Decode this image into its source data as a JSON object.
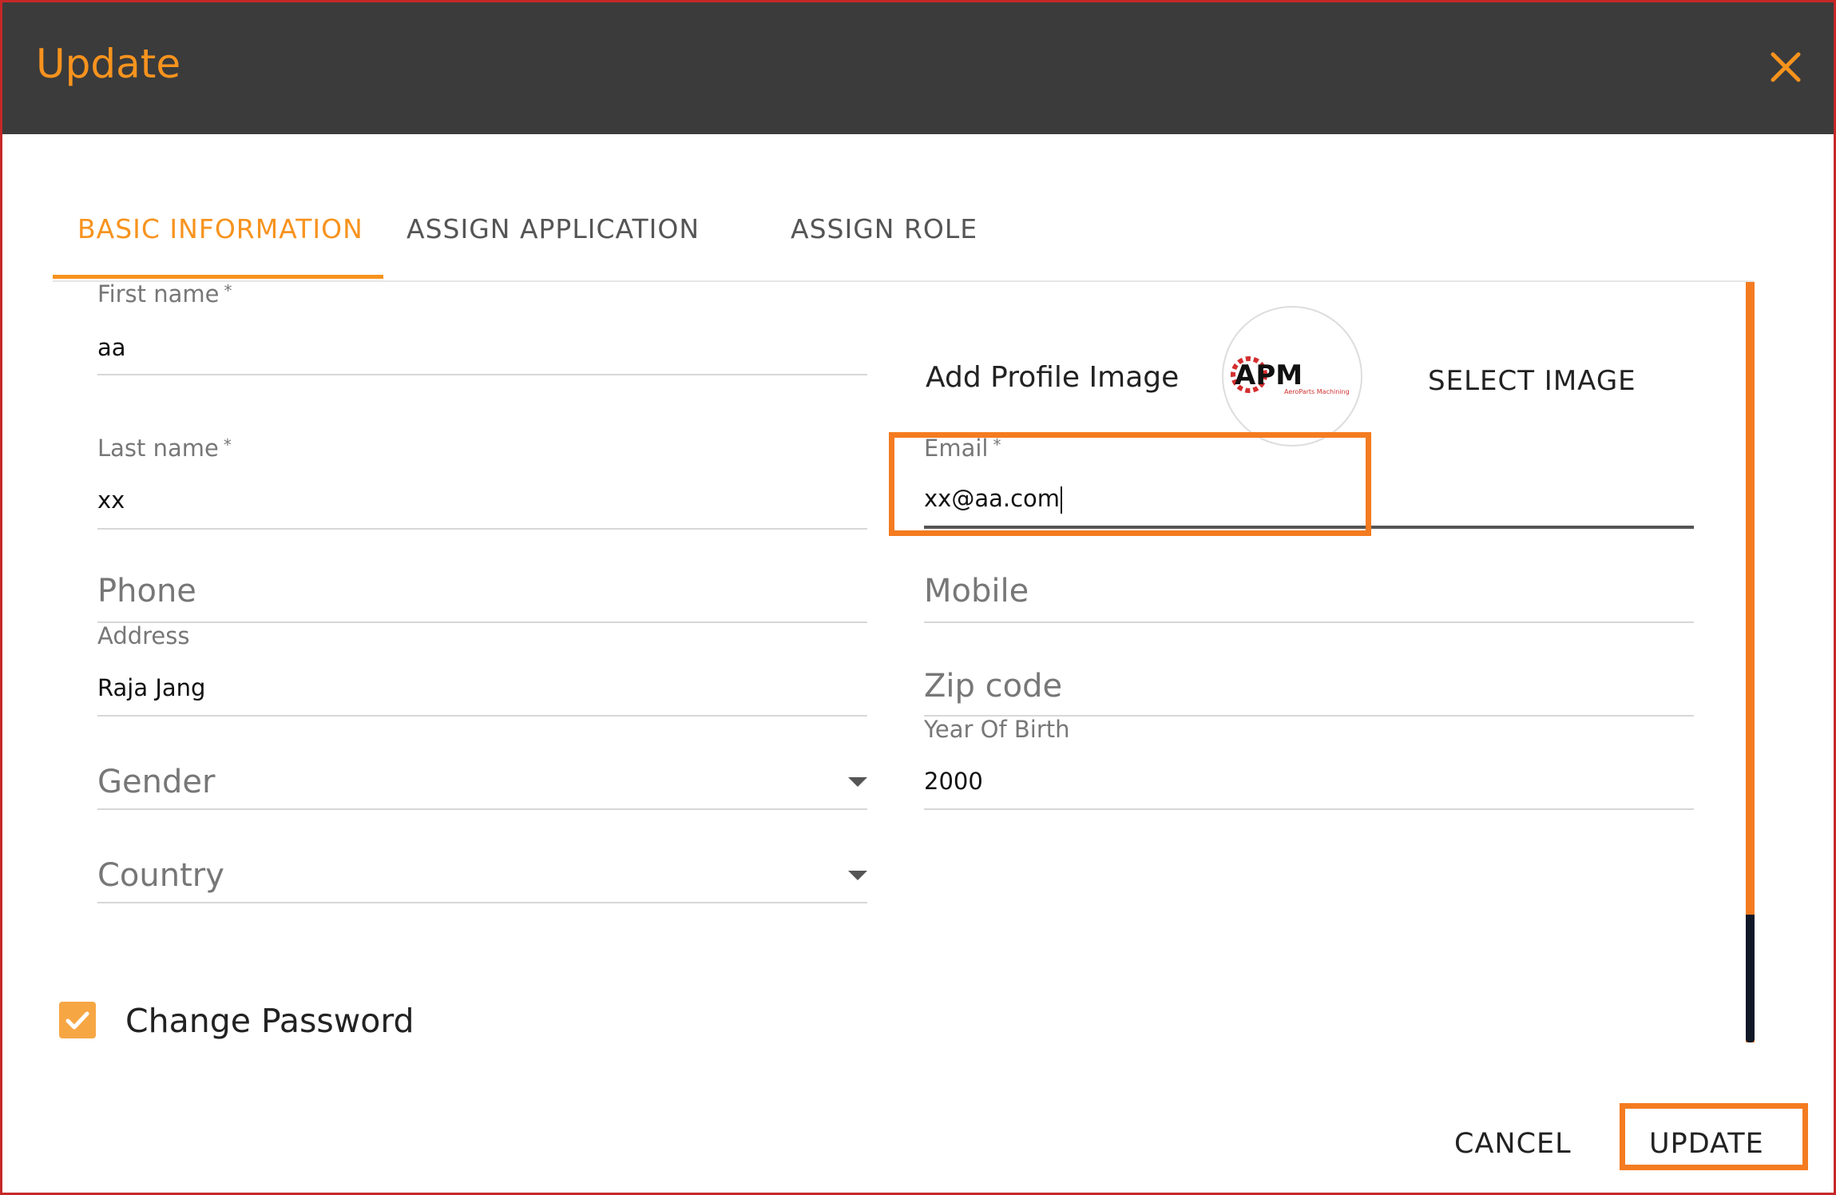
{
  "dialog": {
    "title": "Update"
  },
  "tabs": [
    {
      "label": "BASIC INFORMATION",
      "active": true
    },
    {
      "label": "ASSIGN APPLICATION",
      "active": false
    },
    {
      "label": "ASSIGN ROLE",
      "active": false
    }
  ],
  "form": {
    "first_name": {
      "label": "First name",
      "required_mark": "*",
      "value": "aa"
    },
    "last_name": {
      "label": "Last name",
      "required_mark": "*",
      "value": "xx"
    },
    "email": {
      "label": "Email",
      "required_mark": "*",
      "value": "xx@aa.com"
    },
    "phone": {
      "placeholder": "Phone"
    },
    "mobile": {
      "placeholder": "Mobile"
    },
    "address": {
      "label": "Address",
      "value": "Raja Jang"
    },
    "zip_code": {
      "placeholder": "Zip code"
    },
    "year_of_birth": {
      "label": "Year Of Birth",
      "value": "2000"
    },
    "gender": {
      "placeholder": "Gender"
    },
    "country": {
      "placeholder": "Country"
    }
  },
  "profile": {
    "label": "Add Profile Image",
    "select_label": "SELECT IMAGE",
    "logo_text": "APM",
    "logo_subtext": "AeroParts Machining"
  },
  "change_password": {
    "label": "Change Password",
    "checked": true
  },
  "actions": {
    "cancel_label": "CANCEL",
    "update_label": "UPDATE"
  },
  "colors": {
    "accent": "#f7931e",
    "highlight": "#f47b20",
    "header_bg": "#3b3b3b"
  },
  "icons": {
    "close": "close-icon",
    "dropdown": "chevron-down-icon",
    "check": "check-icon"
  }
}
